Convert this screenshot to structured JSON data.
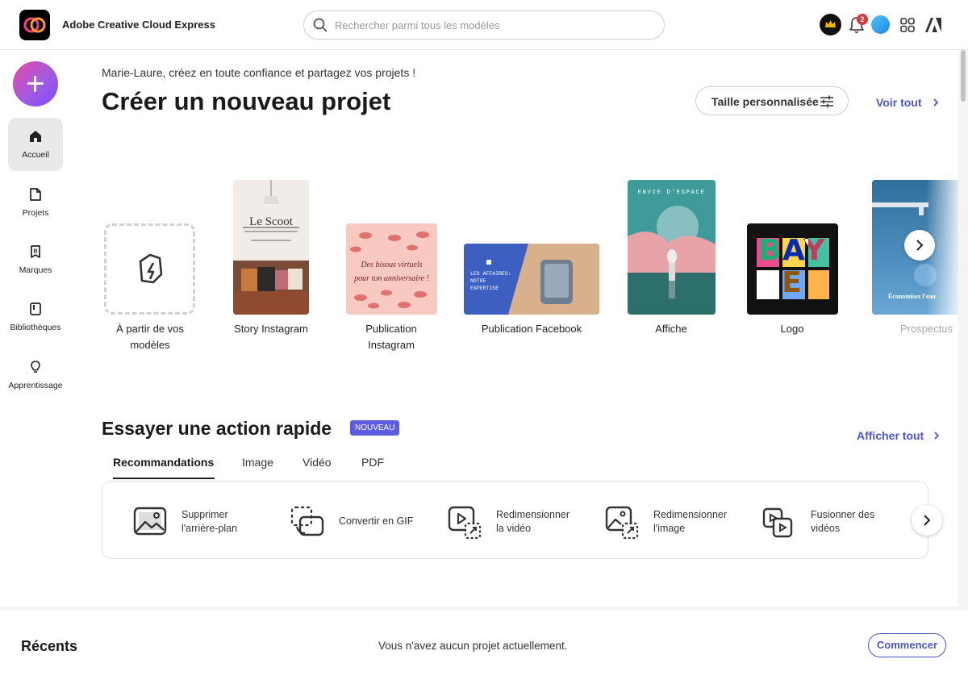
{
  "header": {
    "app_name": "Adobe Creative Cloud Express",
    "search_placeholder": "Rechercher parmi tous les modèles",
    "notification_count": "2"
  },
  "sidebar": {
    "items": [
      {
        "label": "Accueil"
      },
      {
        "label": "Projets"
      },
      {
        "label": "Marques"
      },
      {
        "label": "Bibliothèques"
      },
      {
        "label": "Apprentissage"
      }
    ]
  },
  "main": {
    "greeting": "Marie-Laure, créez en toute confiance et partagez vos projets !",
    "title": "Créer un nouveau projet",
    "custom_size_label": "Taille personnalisée",
    "view_all_label": "Voir tout",
    "templates": [
      {
        "label": "À partir de vos modèles"
      },
      {
        "label": "Story Instagram",
        "thumb_title": "Le Scoot"
      },
      {
        "label": "Publication Instagram",
        "thumb_text": "Des bisous virtuels pour ton anniversaire !"
      },
      {
        "label": "Publication Facebook",
        "thumb_text": "LES AFFAIRES: NOTRE EXPERTISE"
      },
      {
        "label": "Affiche",
        "thumb_text": "ENVIE D'ESPACE"
      },
      {
        "label": "Logo",
        "thumb_text": "BAYE"
      },
      {
        "label": "Prospectus",
        "thumb_text": "Économisez l'eau"
      }
    ]
  },
  "quick_actions": {
    "title": "Essayer une action rapide",
    "badge": "NOUVEAU",
    "show_all_label": "Afficher tout",
    "tabs": [
      {
        "label": "Recommandations"
      },
      {
        "label": "Image"
      },
      {
        "label": "Vidéo"
      },
      {
        "label": "PDF"
      }
    ],
    "actions": [
      {
        "line1": "Supprimer",
        "line2": "l'arrière-plan"
      },
      {
        "line1": "Convertir en GIF",
        "line2": ""
      },
      {
        "line1": "Redimensionner",
        "line2": "la vidéo"
      },
      {
        "line1": "Redimensionner",
        "line2": "l'image"
      },
      {
        "line1": "Fusionner des",
        "line2": "vidéos"
      }
    ]
  },
  "recents": {
    "title": "Récents",
    "empty_message": "Vous n'avez aucun projet actuellement.",
    "start_label": "Commencer"
  },
  "colors": {
    "accent": "#4b55c8",
    "badge": "#5c5ce0",
    "create_gradient_start": "#e649a5",
    "create_gradient_end": "#7c4dff"
  }
}
